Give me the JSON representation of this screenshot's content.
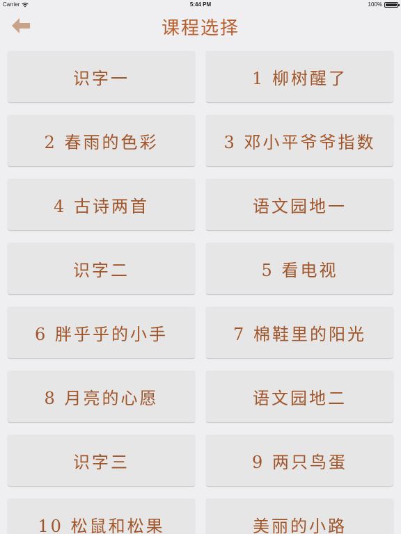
{
  "status_bar": {
    "carrier": "Carrier",
    "time": "5:44 PM",
    "battery": "100%",
    "battery_level": 1.0
  },
  "header": {
    "title": "课程选择",
    "back_icon": "arrow-left-icon"
  },
  "colors": {
    "accent": "#b8612f",
    "button_bg": "#e6e6e6",
    "page_bg": "#efeff1",
    "back_icon": "#c9a28a"
  },
  "lessons": [
    "识字一",
    "1 柳树醒了",
    "2 春雨的色彩",
    "3 邓小平爷爷指数",
    "4 古诗两首",
    "语文园地一",
    "识字二",
    "5 看电视",
    "6 胖乎乎的小手",
    "7 棉鞋里的阳光",
    "8 月亮的心愿",
    "语文园地二",
    "识字三",
    "9 两只鸟蛋",
    "10 松鼠和松果",
    "美丽的小路"
  ]
}
